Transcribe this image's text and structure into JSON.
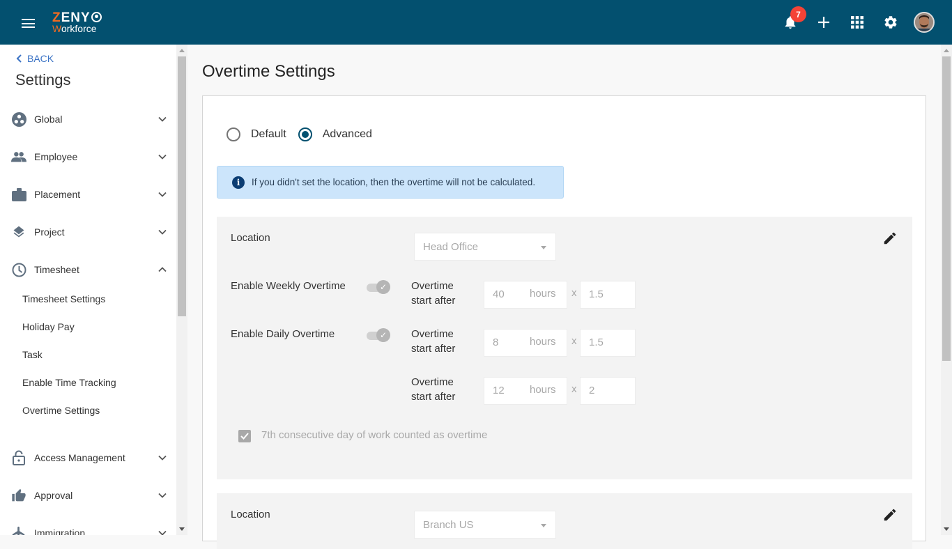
{
  "topbar": {
    "logo_line1_first": "Z",
    "logo_line1_rest": "ENY",
    "logo_line2_first": "W",
    "logo_line2_rest": "orkforce",
    "notification_count": "7",
    "icons": [
      "menu-icon",
      "bell-icon",
      "plus-icon",
      "apps-grid-icon",
      "gear-icon",
      "avatar"
    ]
  },
  "sidebar": {
    "back_label": "BACK",
    "title": "Settings",
    "items": [
      {
        "label": "Global",
        "icon": "global-icon",
        "expanded": false
      },
      {
        "label": "Employee",
        "icon": "people-icon",
        "expanded": false
      },
      {
        "label": "Placement",
        "icon": "briefcase-icon",
        "expanded": false
      },
      {
        "label": "Project",
        "icon": "layers-icon",
        "expanded": false
      },
      {
        "label": "Timesheet",
        "icon": "clock-icon",
        "expanded": true
      },
      {
        "label": "Access Management",
        "icon": "lock-icon",
        "expanded": false
      },
      {
        "label": "Approval",
        "icon": "thumbs-up-icon",
        "expanded": false
      },
      {
        "label": "Immigration",
        "icon": "airplane-icon",
        "expanded": false
      }
    ],
    "timesheet_sub": [
      "Timesheet Settings",
      "Holiday Pay",
      "Task",
      "Enable Time Tracking",
      "Overtime Settings"
    ]
  },
  "main": {
    "page_title": "Overtime Settings",
    "mode_options": [
      {
        "label": "Default",
        "selected": false
      },
      {
        "label": "Advanced",
        "selected": true
      }
    ],
    "alert": "If you didn't set the location, then the overtime will not be calculated.",
    "locations": [
      {
        "label": "Location",
        "value": "Head Office",
        "weekly": {
          "label": "Enable Weekly Overtime",
          "enabled": true
        },
        "daily": {
          "label": "Enable Daily Overtime",
          "enabled": true
        },
        "rules": [
          {
            "label_line1": "Overtime",
            "label_line2": "start after",
            "hours": "40",
            "unit": "hours",
            "x": "x",
            "multiplier": "1.5"
          },
          {
            "label_line1": "Overtime",
            "label_line2": "start after",
            "hours": "8",
            "unit": "hours",
            "x": "x",
            "multiplier": "1.5"
          },
          {
            "label_line1": "Overtime",
            "label_line2": "start after",
            "hours": "12",
            "unit": "hours",
            "x": "x",
            "multiplier": "2"
          }
        ],
        "seventh_day": {
          "label": "7th consecutive day of work counted as overtime",
          "checked": true
        }
      },
      {
        "label": "Location",
        "value": "Branch US"
      }
    ]
  },
  "colors": {
    "topbar": "#03506f",
    "accent_orange": "#f26b21",
    "badge": "#f44336",
    "link": "#3b73c5",
    "alert_bg": "#cce5fb"
  }
}
